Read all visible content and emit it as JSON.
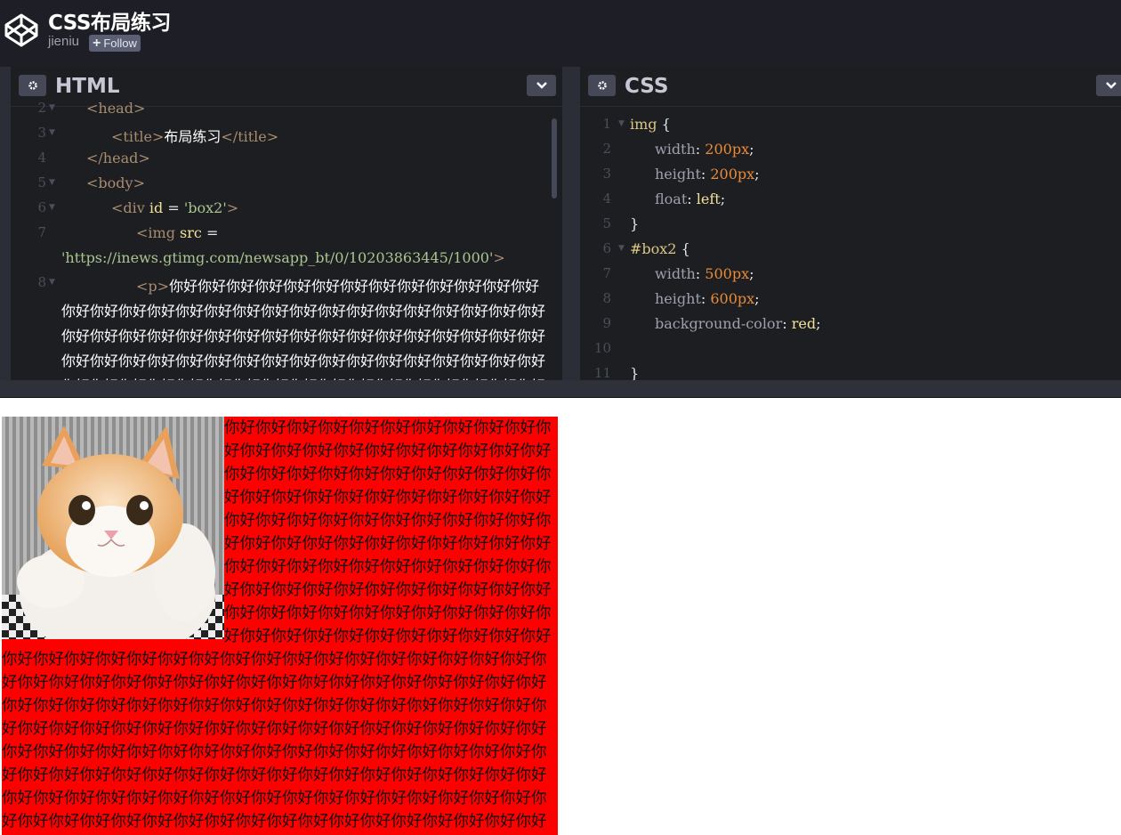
{
  "header": {
    "title": "CSS布局练习",
    "user": "jieniu",
    "follow_label": "Follow"
  },
  "html_pane": {
    "title": "HTML",
    "lines": [
      {
        "num": "2",
        "code": "<head>"
      },
      {
        "num": "3",
        "code": "<title>布局练习</title>"
      },
      {
        "num": "4",
        "code": "</head>"
      },
      {
        "num": "5",
        "code": "<body>"
      },
      {
        "num": "6",
        "code": "<div id = 'box2'>"
      },
      {
        "num": "7",
        "code": "<img src ="
      },
      {
        "num": "",
        "code": "'https://inews.gtimg.com/newsapp_bt/0/10203863445/1000'>"
      },
      {
        "num": "8",
        "code": "<p>你好你好你好你好你好你好你好你好你好你好你好你好你好你好你好你好你好你好你好你好你好你好你好你好你好你好你好你好你好你好你好你好你好你好你好你好你好你好你好你好你好你好你好你好你好你好你好你好你好你好你好你好你好"
      }
    ]
  },
  "css_pane": {
    "title": "CSS",
    "lines": [
      {
        "num": "1",
        "code": "img {"
      },
      {
        "num": "2",
        "code": "width: 200px;"
      },
      {
        "num": "3",
        "code": "height: 200px;"
      },
      {
        "num": "4",
        "code": "float: left;"
      },
      {
        "num": "5",
        "code": "}"
      },
      {
        "num": "6",
        "code": "#box2 {"
      },
      {
        "num": "7",
        "code": "width: 500px;"
      },
      {
        "num": "8",
        "code": "height: 600px;"
      },
      {
        "num": "9",
        "code": "background-color: red;"
      },
      {
        "num": "10",
        "code": ""
      },
      {
        "num": "11",
        "code": "}"
      }
    ]
  },
  "result": {
    "image_subject": "kitten photo",
    "paragraph": "你好你好你好你好你好你好你好你好你好你好你好你好你好你好你好你好你好你好你好你好你好你好你好你好你好你好你好你好你好你好你好你好你好你好你好你好你好你好你好你好你好你好你好你好你好你好你好你好你好你好你好你好你好你好你好你好你好你好你好你好你好你好你好你好你好你好你好你好你好你好你好你好你好你好你好你好你好你好你好你好你好你好你好你好你好你好你好你好你好你好你好你好你好你好你好你好你好你好你好你好你好你好你好你好你好你好你好你好你好你好你好你好你好你好你好你好你好你好你好你好你好你好你好你好你好你好你好你好你好你好你好你好你好你好你好你好你好你好你好你好你好你好你好你好你好你好你好你好你好你好你好你好你好你好你好你好你好你好你好你好你好你好你好你好你好你好你好你好你好你好你好你好你好你好你好你好你好你好你好你好你好你好你好你好你好你好你好你好你好你好你好你好你好你好你好你好你好你好你好你好你好你好你好你好你好你好你好你好你好你好你好你好你好你好你好你好你好你好你好你好你好你好你好你好你好你好你好你好你好你好你好你好你好你好你好你好你好你好你好你好你好你好你好你好你好你好你好你好你好你好你好你好你好你好你好你好你好你好你好"
  },
  "colors": {
    "header_bg": "#1e1f26",
    "editor_bg": "#1d1e22",
    "result_box": "#ff0000"
  }
}
